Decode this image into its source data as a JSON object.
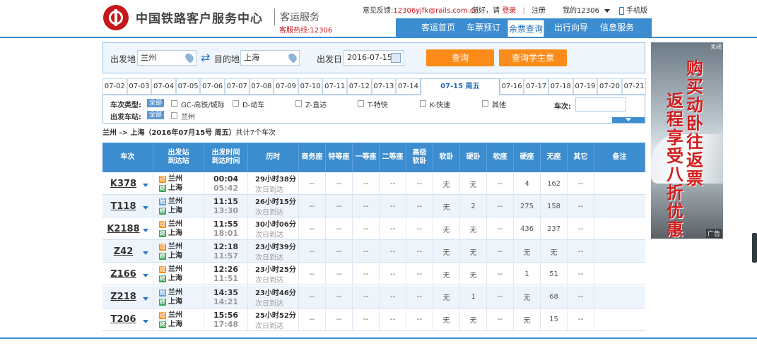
{
  "header": {
    "logo_text": "中国铁路客户服务中心",
    "sub_title": "客运服务",
    "hotline": "客服热线:12306",
    "feedback_label": "意见反馈:",
    "feedback_email": "12306yjfk@rails.com.cn",
    "greeting": "您好，请",
    "login": "登录",
    "separator": "|",
    "register": "注册",
    "my12306": "我的12306",
    "mobile": "手机版"
  },
  "nav": {
    "items": [
      {
        "label": "客运首页"
      },
      {
        "label": "车票预订"
      },
      {
        "label": "余票查询"
      },
      {
        "label": "出行向导"
      },
      {
        "label": "信息服务"
      }
    ]
  },
  "search": {
    "from_label": "出发地",
    "from_value": "兰州",
    "to_label": "目的地",
    "to_value": "上海",
    "date_label": "出发日",
    "date_value": "2016-07-15",
    "query_btn": "查询",
    "student_btn": "查询学生票"
  },
  "dates": [
    "07-02",
    "07-03",
    "07-04",
    "07-05",
    "07-06",
    "07-07",
    "07-08",
    "07-09",
    "07-10",
    "07-11",
    "07-12",
    "07-13",
    "07-14",
    "07-15 周五",
    "07-16",
    "07-17",
    "07-18",
    "07-19",
    "07-20",
    "07-21"
  ],
  "filters": {
    "type_label": "车次类型:",
    "all": "全部",
    "types": [
      "GC-高铁/城际",
      "D-动车",
      "Z-直达",
      "T-特快",
      "K-快速",
      "其他"
    ],
    "station_label": "出发车站:",
    "stations": [
      "兰州"
    ],
    "train_no_label": "车次:"
  },
  "summary": {
    "route": "兰州 -> 上海（2016年07月15号 周五）",
    "count": "共计7个车次"
  },
  "table": {
    "headers": [
      "车次",
      "出发站\n到达站",
      "出发时间\n到达时间",
      "历时",
      "商务座",
      "特等座",
      "一等座",
      "二等座",
      "高级\n软卧",
      "软卧",
      "硬卧",
      "软座",
      "硬座",
      "无座",
      "其它",
      "备注"
    ],
    "rows": [
      {
        "no": "K378",
        "from": "兰州",
        "to": "上海",
        "from_type": "过",
        "dep": "00:04",
        "arr": "05:42",
        "dur": "29小时38分",
        "day": "次日到达",
        "seats": [
          "--",
          "--",
          "--",
          "--",
          "--",
          "无",
          "无",
          "--",
          "4",
          "162",
          "--"
        ]
      },
      {
        "no": "T118",
        "from": "兰州",
        "to": "上海",
        "from_type": "始",
        "dep": "11:15",
        "arr": "13:30",
        "dur": "26小时15分",
        "day": "次日到达",
        "seats": [
          "--",
          "--",
          "--",
          "--",
          "--",
          "无",
          "2",
          "--",
          "275",
          "158",
          "--"
        ]
      },
      {
        "no": "K2188",
        "from": "兰州",
        "to": "上海",
        "from_type": "过",
        "dep": "11:55",
        "arr": "18:01",
        "dur": "30小时06分",
        "day": "次日到达",
        "seats": [
          "--",
          "--",
          "--",
          "--",
          "--",
          "无",
          "无",
          "--",
          "436",
          "237",
          "--"
        ]
      },
      {
        "no": "Z42",
        "from": "兰州",
        "to": "上海",
        "from_type": "过",
        "dep": "12:18",
        "arr": "11:57",
        "dur": "23小时39分",
        "day": "次日到达",
        "seats": [
          "--",
          "--",
          "--",
          "--",
          "--",
          "无",
          "无",
          "--",
          "无",
          "无",
          "--"
        ]
      },
      {
        "no": "Z166",
        "from": "兰州",
        "to": "上海",
        "from_type": "过",
        "dep": "12:26",
        "arr": "11:51",
        "dur": "23小时25分",
        "day": "次日到达",
        "seats": [
          "--",
          "--",
          "--",
          "--",
          "--",
          "无",
          "无",
          "--",
          "1",
          "51",
          "--"
        ]
      },
      {
        "no": "Z218",
        "from": "兰州",
        "to": "上海",
        "from_type": "始",
        "dep": "14:35",
        "arr": "14:21",
        "dur": "23小时46分",
        "day": "次日到达",
        "seats": [
          "--",
          "--",
          "--",
          "--",
          "--",
          "无",
          "1",
          "--",
          "无",
          "68",
          "--"
        ]
      },
      {
        "no": "T206",
        "from": "兰州",
        "to": "上海",
        "from_type": "过",
        "dep": "15:56",
        "arr": "17:48",
        "dur": "25小时52分",
        "day": "次日到达",
        "seats": [
          "--",
          "--",
          "--",
          "--",
          "--",
          "无",
          "无",
          "--",
          "无",
          "15",
          "--"
        ]
      }
    ]
  },
  "ad": {
    "line1": "购买动卧往返票",
    "line2": "返程享受八折优惠",
    "close": "关闭",
    "label": "广告"
  }
}
